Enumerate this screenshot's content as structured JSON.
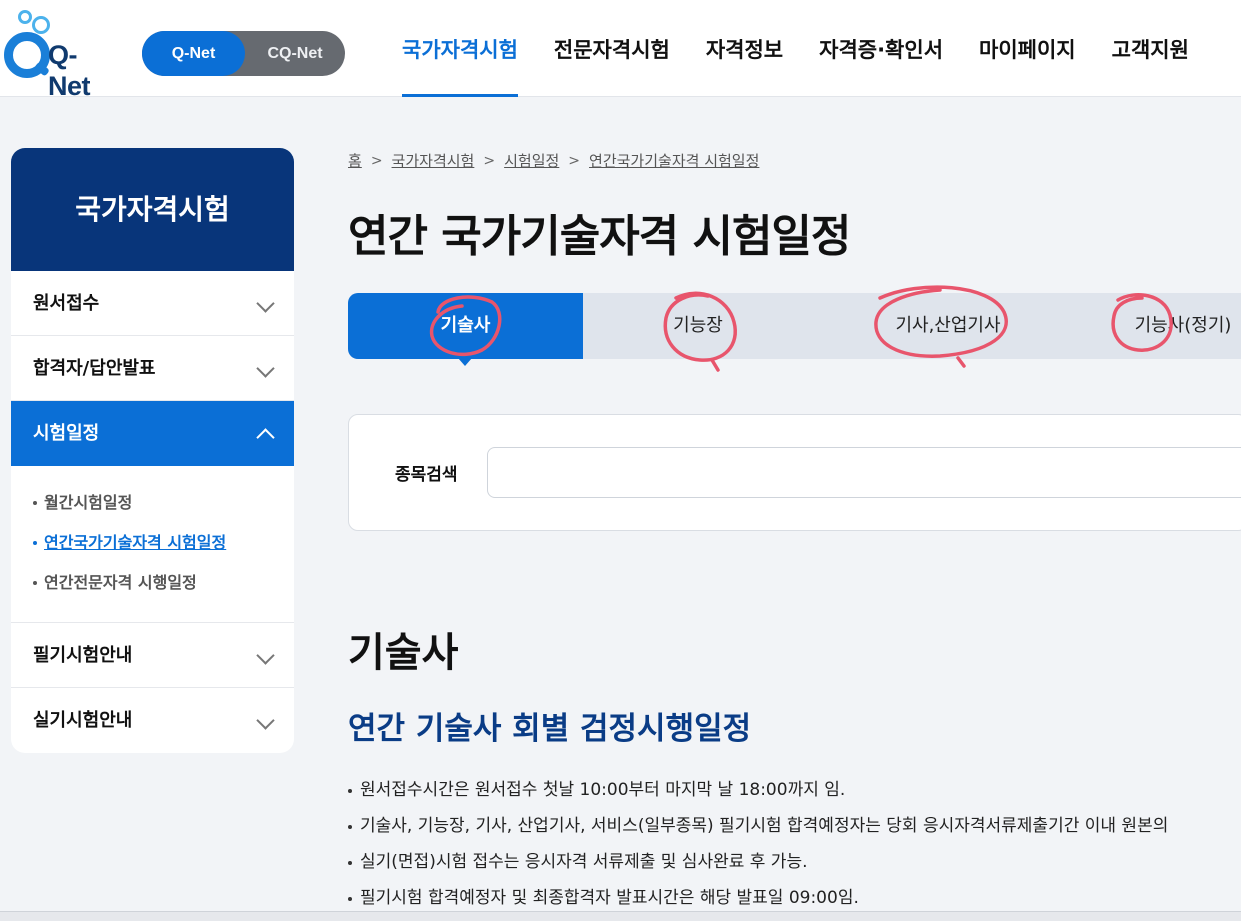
{
  "logo": {
    "text": "Q-Net"
  },
  "toggle": {
    "active": "Q-Net",
    "other": "CQ-Net"
  },
  "nav": {
    "items": [
      {
        "label": "국가자격시험"
      },
      {
        "label": "전문자격시험"
      },
      {
        "label": "자격정보"
      },
      {
        "label": "자격증·확인서"
      },
      {
        "label": "마이페이지"
      },
      {
        "label": "고객지원"
      }
    ]
  },
  "sidebar": {
    "title": "국가자격시험",
    "items": [
      {
        "label": "원서접수"
      },
      {
        "label": "합격자/답안발표"
      },
      {
        "label": "시험일정"
      },
      {
        "label": "필기시험안내"
      },
      {
        "label": "실기시험안내"
      }
    ],
    "sub_items": [
      {
        "label": "월간시험일정"
      },
      {
        "label": "연간국가기술자격 시험일정"
      },
      {
        "label": "연간전문자격 시행일정"
      }
    ]
  },
  "breadcrumb": [
    "홈",
    "국가자격시험",
    "시험일정",
    "연간국가기술자격 시험일정"
  ],
  "page": {
    "title": "연간 국가기술자격 시험일정"
  },
  "tabs": [
    {
      "label": "기술사"
    },
    {
      "label": "기능장"
    },
    {
      "label": "기사,산업기사"
    },
    {
      "label": "기능사(정기)"
    }
  ],
  "search": {
    "label": "종목검색",
    "value": "",
    "placeholder": ""
  },
  "section": {
    "title": "기술사",
    "subtitle": "연간 기술사 회별 검정시행일정",
    "notes": [
      "원서접수시간은 원서접수 첫날 10:00부터 마지막 날 18:00까지 임.",
      "기술사, 기능장, 기사, 산업기사, 서비스(일부종목) 필기시험 합격예정자는 당회 응시자격서류제출기간 이내 원본의",
      "실기(면접)시험 접수는 응시자격 서류제출 및 심사완료 후 가능.",
      "필기시험 합격예정자 및 최종합격자 발표시간은 해당 발표일 09:00임."
    ]
  },
  "colors": {
    "primary": "#0b6fd6",
    "navy": "#08357a",
    "annotation": "#e8556c"
  }
}
